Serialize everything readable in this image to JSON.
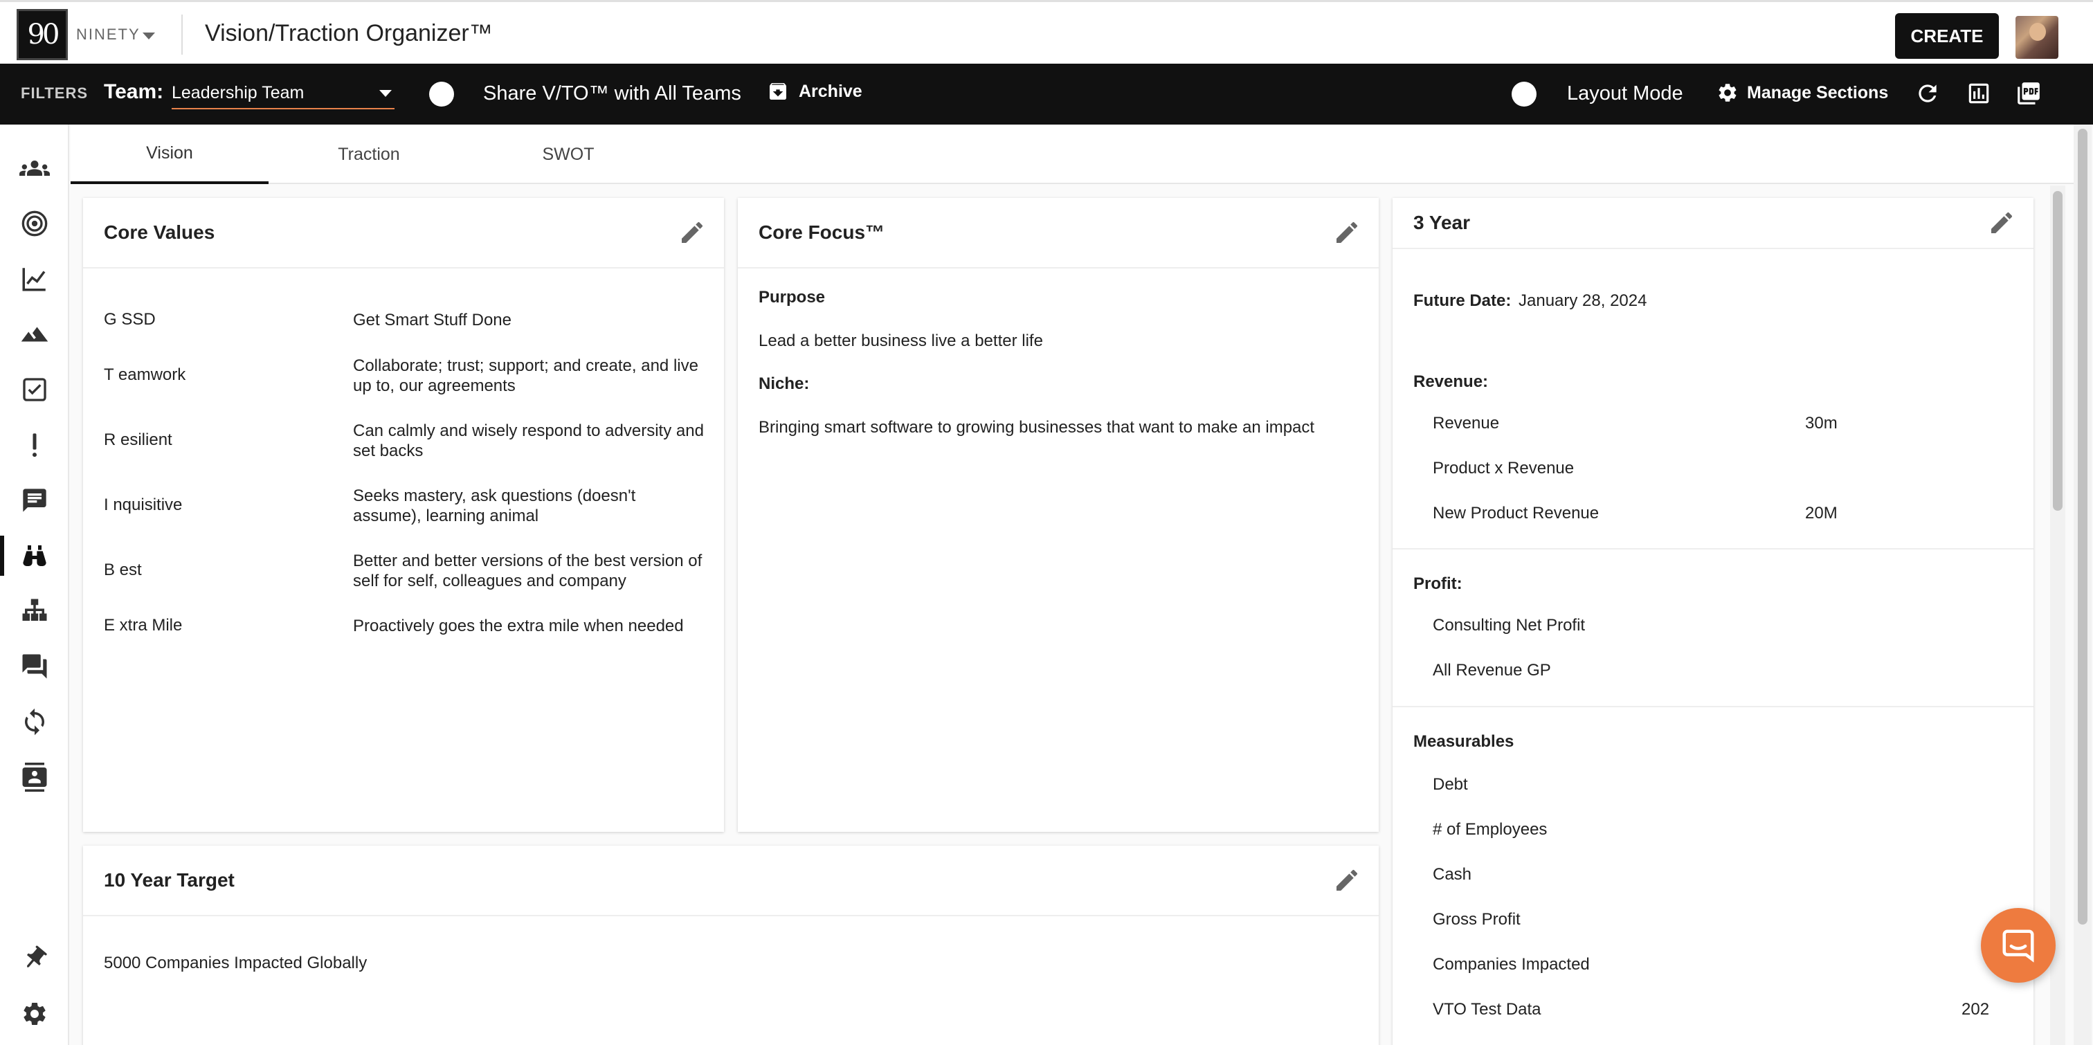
{
  "header": {
    "logo_text": "90",
    "brand": "NINETY",
    "title": "Vision/Traction Organizer™",
    "create_label": "CREATE"
  },
  "filterbar": {
    "filters_label": "FILTERS",
    "team_label": "Team:",
    "team_value": "Leadership Team",
    "share_label": "Share V/TO™ with All Teams",
    "archive_label": "Archive",
    "layout_label": "Layout Mode",
    "manage_label": "Manage Sections"
  },
  "tabs": [
    {
      "label": "Vision"
    },
    {
      "label": "Traction"
    },
    {
      "label": "SWOT"
    }
  ],
  "core_values": {
    "title": "Core Values",
    "items": [
      {
        "name": "G SSD",
        "desc": "Get Smart Stuff Done"
      },
      {
        "name": "T eamwork",
        "desc": "Collaborate; trust; support; and create, and live up to, our agreements"
      },
      {
        "name": "R esilient",
        "desc": "Can calmly and wisely respond to adversity and set backs"
      },
      {
        "name": "I nquisitive",
        "desc": "Seeks mastery, ask questions (doesn't assume), learning animal"
      },
      {
        "name": "B est",
        "desc": "Better and better versions of the best version of self for self, colleagues and company"
      },
      {
        "name": "E xtra Mile",
        "desc": "Proactively goes the extra mile when needed"
      }
    ]
  },
  "core_focus": {
    "title": "Core Focus™",
    "purpose_label": "Purpose",
    "purpose": "Lead a better business live a better life",
    "niche_label": "Niche:",
    "niche": "Bringing smart software to growing businesses that want to make an impact"
  },
  "three_year": {
    "title": "3 Year",
    "future_date_label": "Future Date:",
    "future_date": "January 28, 2024",
    "revenue_label": "Revenue:",
    "revenue_items": [
      {
        "name": "Revenue",
        "value": "30m"
      },
      {
        "name": "Product x Revenue",
        "value": ""
      },
      {
        "name": "New Product Revenue",
        "value": "20M"
      }
    ],
    "profit_label": "Profit:",
    "profit_items": [
      {
        "name": "Consulting Net Profit",
        "value": ""
      },
      {
        "name": "All Revenue GP",
        "value": ""
      }
    ],
    "measurables_label": "Measurables",
    "measurable_items": [
      {
        "name": "Debt",
        "value": ""
      },
      {
        "name": "# of Employees",
        "value": ""
      },
      {
        "name": "Cash",
        "value": ""
      },
      {
        "name": "Gross Profit",
        "value": ""
      },
      {
        "name": "Companies Impacted",
        "value": ""
      },
      {
        "name": "VTO Test Data",
        "value": "202"
      }
    ]
  },
  "ten_year": {
    "title": "10 Year Target",
    "value": "5000 Companies Impacted Globally"
  },
  "sidebar": {
    "items": [
      {
        "icon": "people-icon"
      },
      {
        "icon": "target-icon"
      },
      {
        "icon": "line-chart-icon"
      },
      {
        "icon": "mountain-icon"
      },
      {
        "icon": "checkbox-icon"
      },
      {
        "icon": "exclamation-icon"
      },
      {
        "icon": "feedback-icon"
      },
      {
        "icon": "binoculars-icon"
      },
      {
        "icon": "org-chart-icon"
      },
      {
        "icon": "forum-icon"
      },
      {
        "icon": "sync-icon"
      },
      {
        "icon": "directory-icon"
      }
    ],
    "bottom": [
      {
        "icon": "pin-icon"
      },
      {
        "icon": "gear-icon"
      }
    ]
  },
  "colors": {
    "accent": "#ee7b3f",
    "header_bg": "#111111",
    "select_underline": "#e8824a"
  }
}
